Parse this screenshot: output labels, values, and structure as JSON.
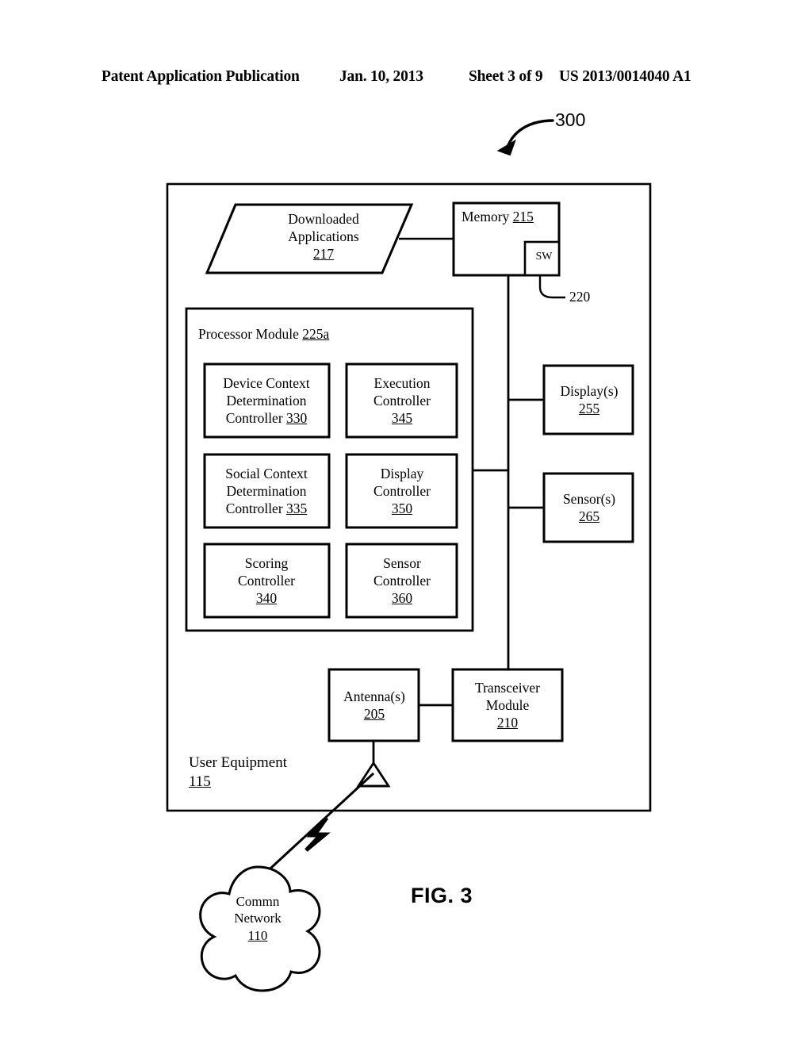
{
  "header": {
    "publication": "Patent Application Publication",
    "date": "Jan. 10, 2013",
    "sheet": "Sheet 3 of 9",
    "number": "US 2013/0014040 A1"
  },
  "figure": {
    "label": "FIG. 3",
    "callout": "300",
    "outer_block": {
      "title": "User Equipment",
      "ref": "115"
    },
    "blocks": {
      "downloaded_applications": {
        "line1": "Downloaded",
        "line2": "Applications",
        "ref": "217",
        "shape": "parallelogram"
      },
      "memory": {
        "line1": "Memory",
        "ref": "215",
        "shape": "rect"
      },
      "sw": {
        "line1": "SW",
        "ref": "220",
        "shape": "rect"
      },
      "processor_module": {
        "line1": "Processor Module",
        "ref": "225a",
        "shape": "rect"
      },
      "device_context_determination_controller": {
        "line1": "Device Context",
        "line2": "Determination",
        "line3": "Controller",
        "ref": "330",
        "shape": "rect"
      },
      "execution_controller": {
        "line1": "Execution",
        "line2": "Controller",
        "ref": "345",
        "shape": "rect"
      },
      "social_context_determination_controller": {
        "line1": "Social Context",
        "line2": "Determination",
        "line3": "Controller",
        "ref": "335",
        "shape": "rect"
      },
      "display_controller": {
        "line1": "Display",
        "line2": "Controller",
        "ref": "350",
        "shape": "rect"
      },
      "scoring_controller": {
        "line1": "Scoring",
        "line2": "Controller",
        "ref": "340",
        "shape": "rect"
      },
      "sensor_controller": {
        "line1": "Sensor",
        "line2": "Controller",
        "ref": "360",
        "shape": "rect"
      },
      "displays": {
        "line1": "Display(s)",
        "ref": "255",
        "shape": "rect"
      },
      "sensors": {
        "line1": "Sensor(s)",
        "ref": "265",
        "shape": "rect"
      },
      "antennas": {
        "line1": "Antenna(s)",
        "ref": "205",
        "shape": "rect"
      },
      "transceiver_module": {
        "line1": "Transceiver",
        "line2": "Module",
        "ref": "210",
        "shape": "rect"
      },
      "comm_network": {
        "line1": "Commn",
        "line2": "Network",
        "ref": "110",
        "shape": "cloud"
      }
    },
    "colors": {
      "stroke": "#000000",
      "fill": "#ffffff",
      "text": "#000000"
    }
  }
}
